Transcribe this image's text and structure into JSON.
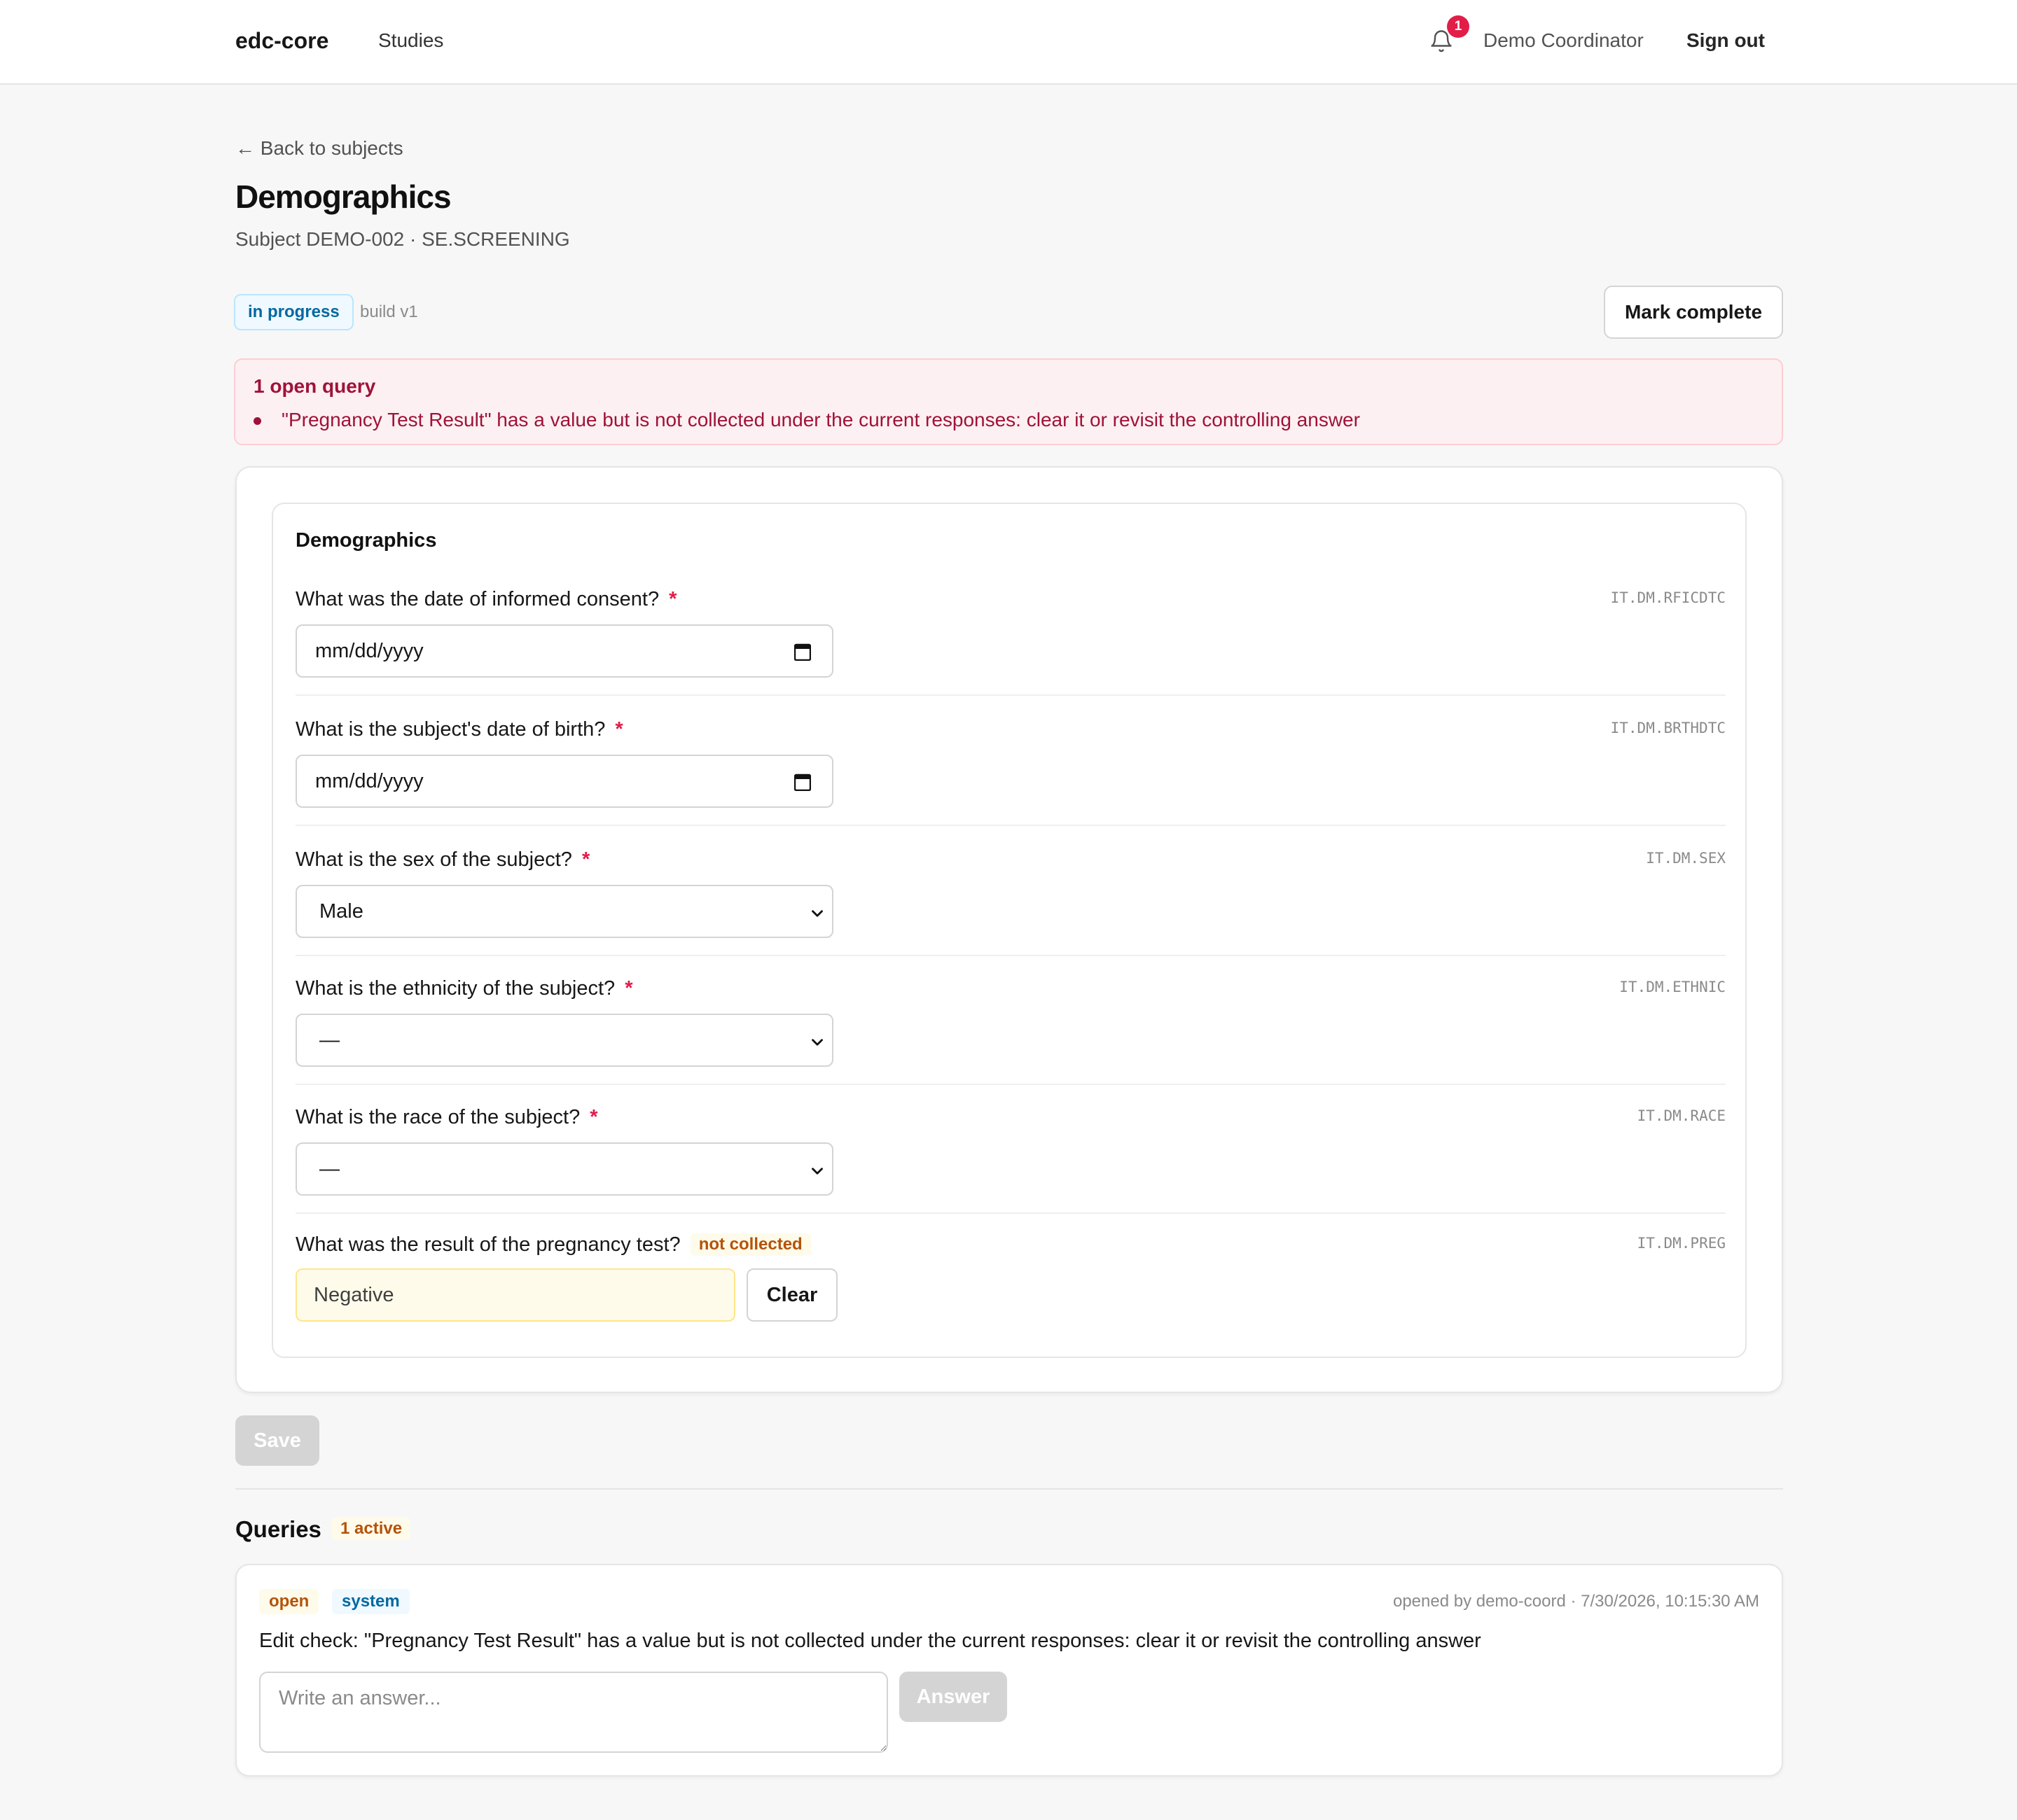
{
  "header": {
    "brand": "edc-core",
    "nav_studies": "Studies",
    "notification_count": "1",
    "user_name": "Demo Coordinator",
    "sign_out": "Sign out"
  },
  "page": {
    "back_link": "← Back to subjects",
    "title": "Demographics",
    "subtitle": "Subject DEMO-002 · SE.SCREENING",
    "status": "in progress",
    "build": "build v1",
    "mark_complete": "Mark complete"
  },
  "alert": {
    "title": "1 open query",
    "items": [
      "\"Pregnancy Test Result\" has a value but is not collected under the current responses: clear it or revisit the controlling answer"
    ]
  },
  "form": {
    "section_title": "Demographics",
    "required_mark": "*",
    "fields": [
      {
        "label": "What was the date of informed consent?",
        "oid": "IT.DM.RFICDTC",
        "value": "mm/dd/yyyy"
      },
      {
        "label": "What is the subject's date of birth?",
        "oid": "IT.DM.BRTHDTC",
        "value": "mm/dd/yyyy"
      },
      {
        "label": "What is the sex of the subject?",
        "oid": "IT.DM.SEX",
        "value": "Male"
      },
      {
        "label": "What is the ethnicity of the subject?",
        "oid": "IT.DM.ETHNIC",
        "value": "—"
      },
      {
        "label": "What is the race of the subject?",
        "oid": "IT.DM.RACE",
        "value": "—"
      },
      {
        "label": "What was the result of the pregnancy test?",
        "oid": "IT.DM.PREG",
        "value": "Negative",
        "badge": "not collected",
        "clear_label": "Clear"
      }
    ],
    "save_label": "Save"
  },
  "queries": {
    "title": "Queries",
    "active_badge": "1 active",
    "items": [
      {
        "status": "open",
        "source": "system",
        "meta": "opened by demo-coord · 7/30/2026, 10:15:30 AM",
        "text": "Edit check: \"Pregnancy Test Result\" has a value but is not collected under the current responses: clear it or revisit the controlling answer",
        "answer_placeholder": "Write an answer...",
        "answer_label": "Answer"
      }
    ]
  },
  "colors": {
    "accent_blue": "#0369a1",
    "alert_red": "#9f1239",
    "required_red": "#e11d48",
    "warning_amber": "#b45309"
  }
}
